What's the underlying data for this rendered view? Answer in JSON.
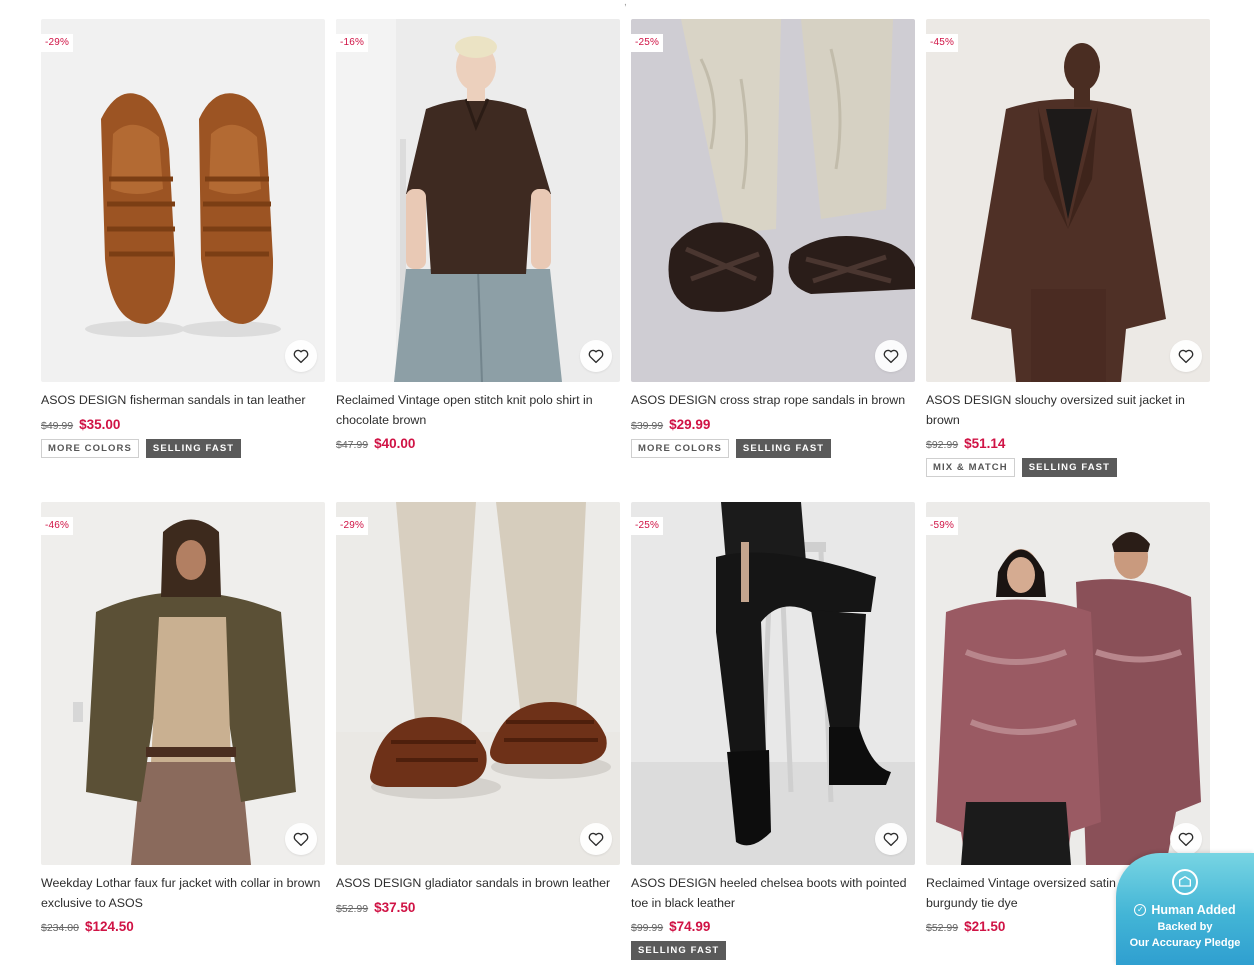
{
  "top_marker": ",",
  "colors": {
    "sale_red": "#d01345",
    "badge_dark": "#5a5a5a",
    "pledge_teal": "#43b5d6"
  },
  "products": [
    {
      "discount": "-29%",
      "title": "ASOS DESIGN fisherman sandals in tan leather",
      "old_price": "$49.99",
      "price": "$35.00",
      "badges": [
        "MORE COLORS",
        "SELLING FAST"
      ],
      "image": "tan-leather-fisherman-sandals"
    },
    {
      "discount": "-16%",
      "title": "Reclaimed Vintage open stitch knit polo shirt in chocolate brown",
      "old_price": "$47.99",
      "price": "$40.00",
      "badges": [],
      "image": "model-brown-knit-polo"
    },
    {
      "discount": "-25%",
      "title": "ASOS DESIGN cross strap rope sandals in brown",
      "old_price": "$39.99",
      "price": "$29.99",
      "badges": [
        "MORE COLORS",
        "SELLING FAST"
      ],
      "image": "rope-sandals-linen-trousers"
    },
    {
      "discount": "-45%",
      "title": "ASOS DESIGN slouchy oversized suit jacket in brown",
      "old_price": "$92.99",
      "price": "$51.14",
      "badges": [
        "MIX & MATCH",
        "SELLING FAST"
      ],
      "image": "model-brown-suit-jacket"
    },
    {
      "discount": "-46%",
      "title": "Weekday Lothar faux fur jacket with collar in brown exclusive to ASOS",
      "old_price": "$234.00",
      "price": "$124.50",
      "badges": [],
      "image": "model-faux-fur-jacket"
    },
    {
      "discount": "-29%",
      "title": "ASOS DESIGN gladiator sandals in brown leather",
      "old_price": "$52.99",
      "price": "$37.50",
      "badges": [],
      "image": "brown-gladiator-sandals"
    },
    {
      "discount": "-25%",
      "title": "ASOS DESIGN heeled chelsea boots with pointed toe in black leather",
      "old_price": "$99.99",
      "price": "$74.99",
      "badges": [
        "SELLING FAST"
      ],
      "image": "model-black-chelsea-boots"
    },
    {
      "discount": "-59%",
      "title": "Reclaimed Vintage oversized satin shirt in burgundy tie dye",
      "old_price": "$52.99",
      "price": "$21.50",
      "badges": [],
      "image": "models-burgundy-satin-shirts"
    }
  ],
  "pledge": {
    "headline": "Human Added",
    "line1": "Backed by",
    "line2": "Our Accuracy Pledge"
  }
}
